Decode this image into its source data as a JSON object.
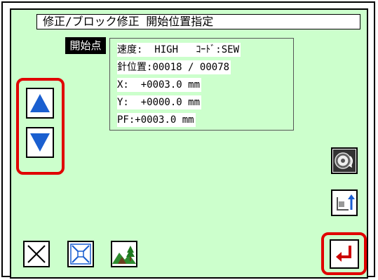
{
  "header": {
    "title": "修正/ブロック修正 開始位置指定"
  },
  "start_point": {
    "label": "開始点"
  },
  "info": {
    "speed_label": "速度:",
    "speed_value": "HIGH",
    "code_label": "ｺｰﾄﾞ:",
    "code_value": "SEW",
    "needle_label": "針位置:",
    "needle_current": "00018",
    "needle_separator": "/",
    "needle_total": "00078",
    "x_label": "X:",
    "x_value": "+0003.0",
    "y_label": "Y:",
    "y_value": "+0000.0",
    "pf_label": "PF:",
    "pf_value": "+0003.0",
    "unit": "mm"
  },
  "colors": {
    "background": "#ccffcc",
    "highlight": "#e00000",
    "arrow_blue": "#1a5fd0",
    "enter_red": "#cc0000"
  },
  "icons": {
    "up": "arrow-up-icon",
    "down": "arrow-down-icon",
    "cancel": "cancel-x-icon",
    "fit": "fit-to-center-icon",
    "view": "landscape-view-icon",
    "handwheel": "handwheel-rotate-icon",
    "frame": "frame-origin-icon",
    "enter": "enter-return-icon"
  }
}
